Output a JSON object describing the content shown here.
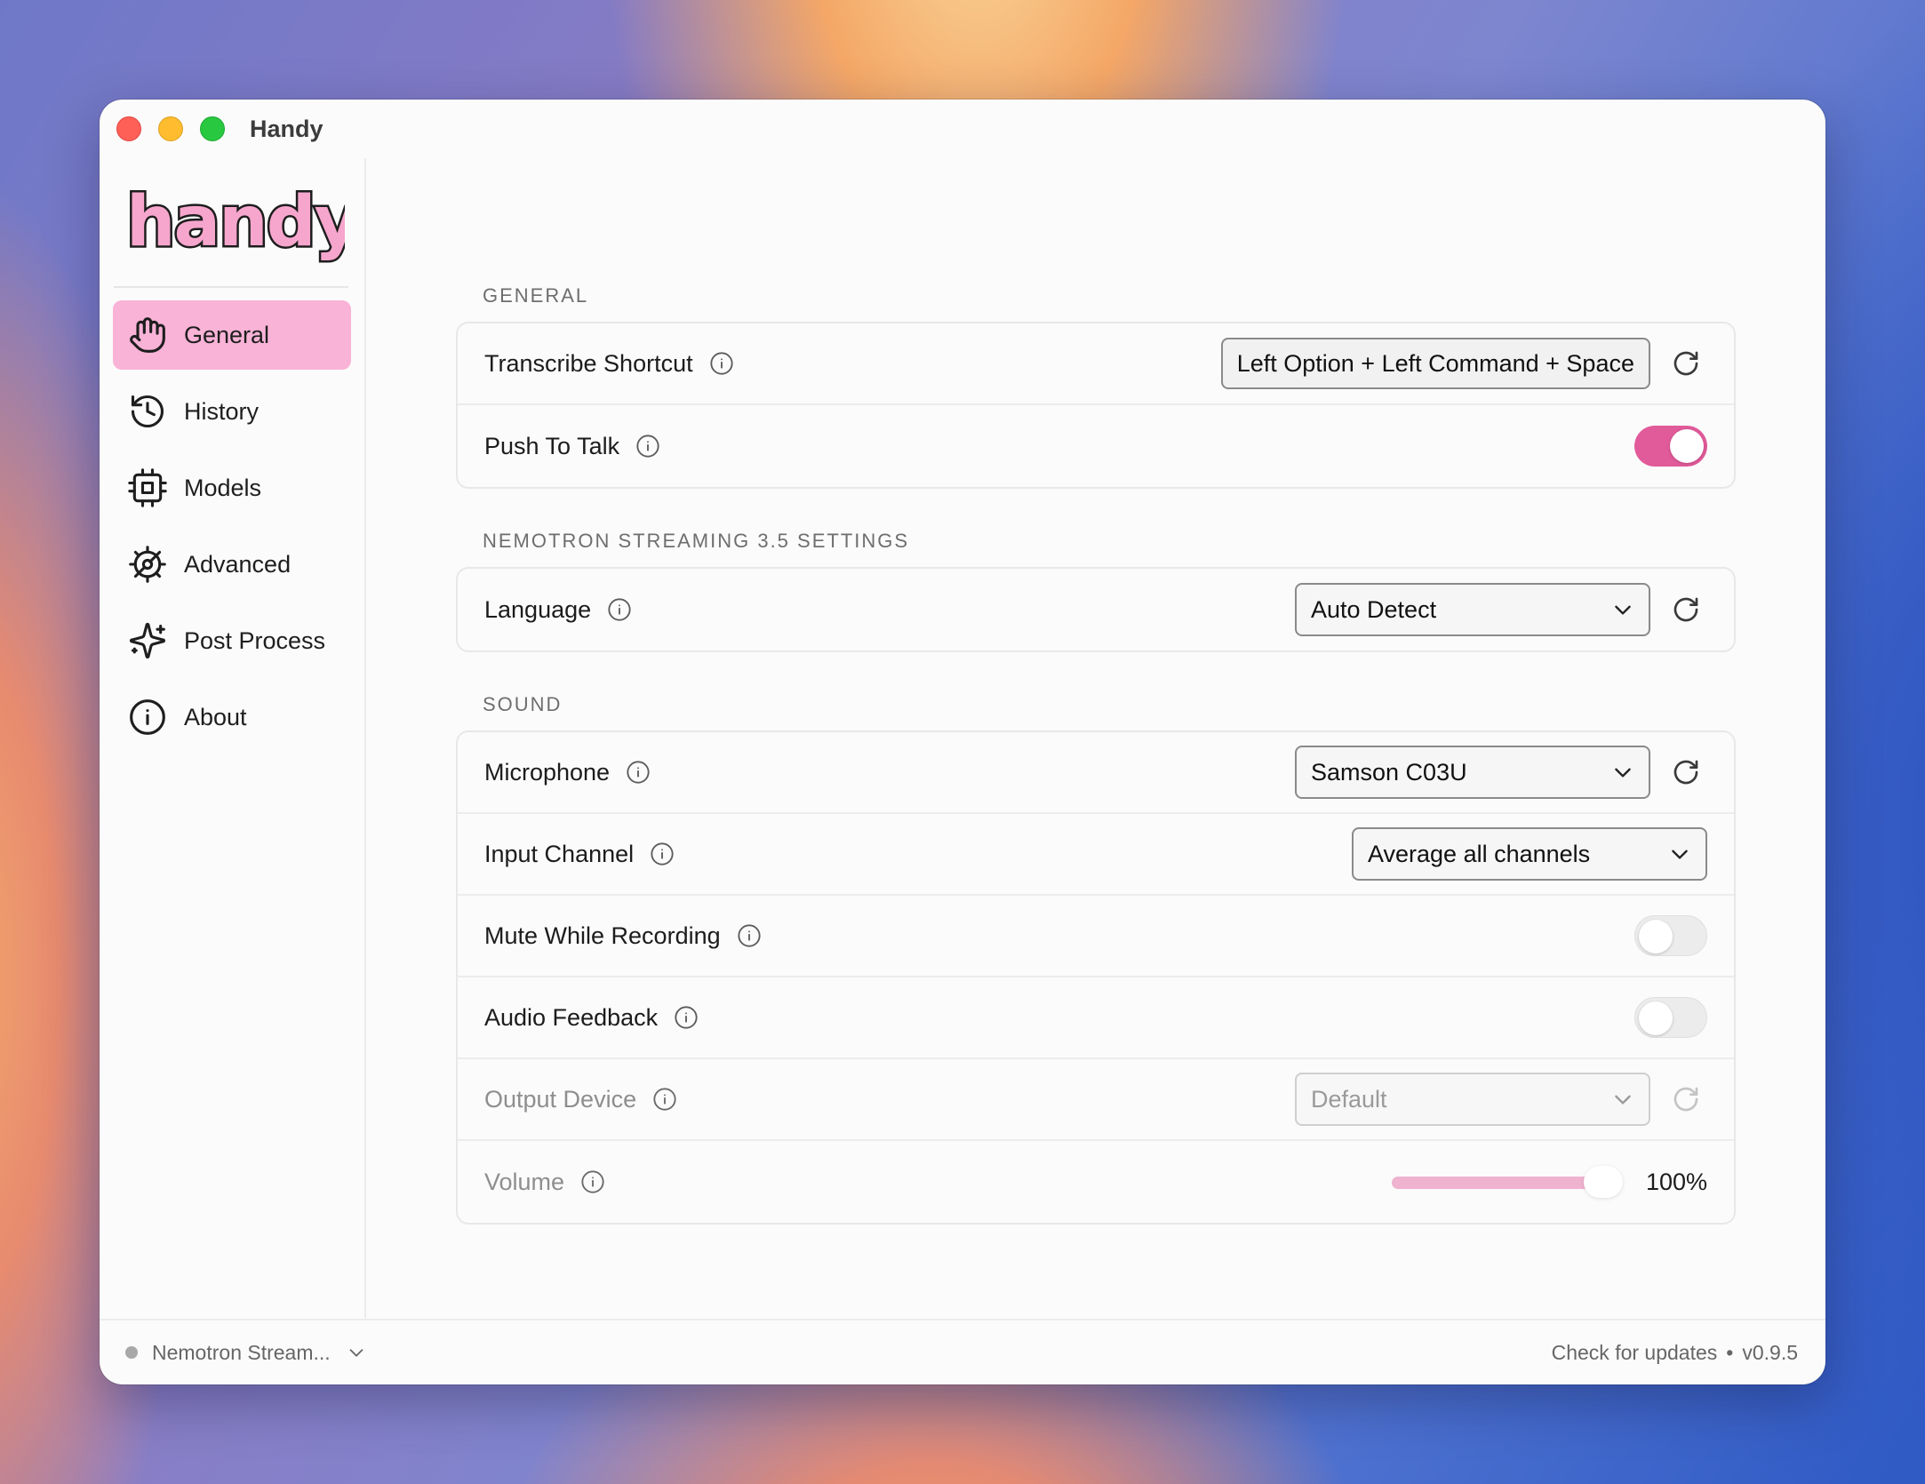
{
  "window": {
    "title": "Handy"
  },
  "sidebar": {
    "logo_text": "handy",
    "items": [
      {
        "label": "General",
        "icon": "hand-icon",
        "active": true
      },
      {
        "label": "History",
        "icon": "history-icon"
      },
      {
        "label": "Models",
        "icon": "cpu-icon"
      },
      {
        "label": "Advanced",
        "icon": "gear-icon"
      },
      {
        "label": "Post Process",
        "icon": "sparkles-icon"
      },
      {
        "label": "About",
        "icon": "info-circle-icon"
      }
    ]
  },
  "sections": {
    "general": {
      "title": "GENERAL",
      "transcribe_shortcut": {
        "label": "Transcribe Shortcut",
        "value": "Left Option + Left Command + Space"
      },
      "push_to_talk": {
        "label": "Push To Talk",
        "enabled": true
      }
    },
    "model": {
      "title": "NEMOTRON STREAMING 3.5 SETTINGS",
      "language": {
        "label": "Language",
        "value": "Auto Detect"
      }
    },
    "sound": {
      "title": "SOUND",
      "microphone": {
        "label": "Microphone",
        "value": "Samson C03U"
      },
      "input_channel": {
        "label": "Input Channel",
        "value": "Average all channels"
      },
      "mute_while_recording": {
        "label": "Mute While Recording",
        "enabled": false
      },
      "audio_feedback": {
        "label": "Audio Feedback",
        "enabled": false
      },
      "output_device": {
        "label": "Output Device",
        "value": "Default"
      },
      "volume": {
        "label": "Volume",
        "value": "100%",
        "level": 1.0
      }
    }
  },
  "footer": {
    "model_name": "Nemotron Stream...",
    "check_updates": "Check for updates",
    "separator": "•",
    "version": "v0.9.5"
  },
  "colors": {
    "accent": "#e15a9a",
    "active_nav": "#f9b3d7",
    "slider_fill": "#efb3d0"
  }
}
